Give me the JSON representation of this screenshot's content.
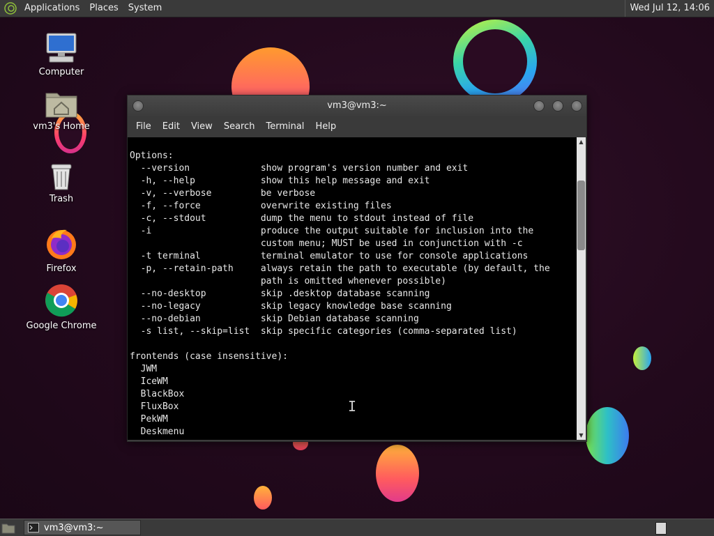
{
  "top_panel": {
    "menu": [
      "Applications",
      "Places",
      "System"
    ],
    "clock": "Wed Jul 12, 14:06"
  },
  "desktop_icons": [
    {
      "label": "Computer",
      "icon": "computer-icon"
    },
    {
      "label": "vm3's Home",
      "icon": "home-folder-icon"
    },
    {
      "label": "Trash",
      "icon": "trash-icon"
    },
    {
      "label": "Firefox",
      "icon": "firefox-icon"
    },
    {
      "label": "Google Chrome",
      "icon": "chrome-icon"
    }
  ],
  "window": {
    "title": "vm3@vm3:~",
    "menu": [
      "File",
      "Edit",
      "View",
      "Search",
      "Terminal",
      "Help"
    ]
  },
  "terminal": {
    "lines": [
      "Options:",
      "  --version             show program's version number and exit",
      "  -h, --help            show this help message and exit",
      "  -v, --verbose         be verbose",
      "  -f, --force           overwrite existing files",
      "  -c, --stdout          dump the menu to stdout instead of file",
      "  -i                    produce the output suitable for inclusion into the",
      "                        custom menu; MUST be used in conjunction with -c",
      "  -t terminal           terminal emulator to use for console applications",
      "  -p, --retain-path     always retain the path to executable (by default, the",
      "                        path is omitted whenever possible)",
      "  --no-desktop          skip .desktop database scanning",
      "  --no-legacy           skip legacy knowledge base scanning",
      "  --no-debian           skip Debian database scanning",
      "  -s list, --skip=list  skip specific categories (comma-separated list)",
      "",
      "frontends (case insensitive):",
      "  JWM",
      "  IceWM",
      "  BlackBox",
      "  FluxBox",
      "  PekWM",
      "  Deskmenu"
    ]
  },
  "taskbar": {
    "task_label": "vm3@vm3:~"
  }
}
